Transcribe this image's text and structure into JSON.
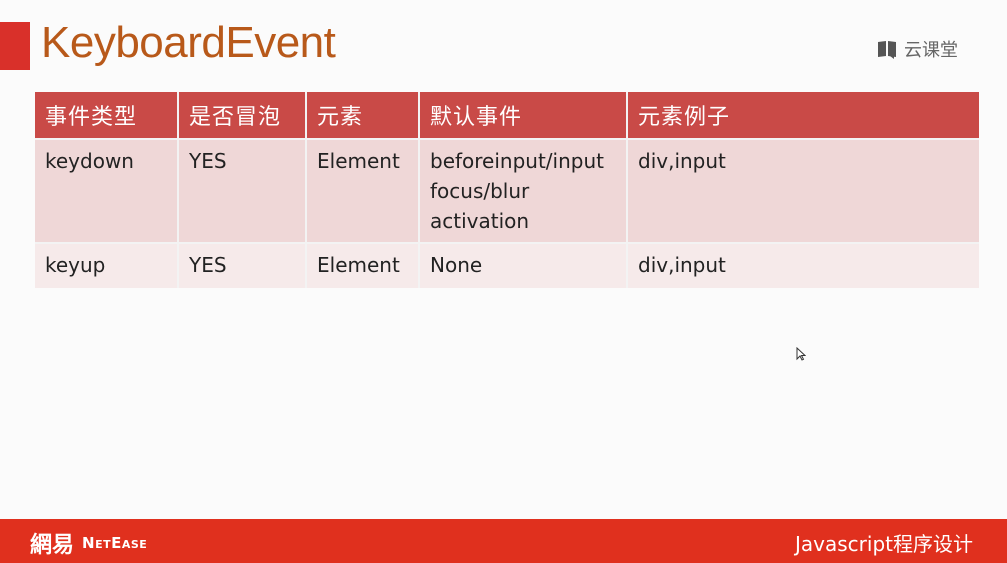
{
  "slide": {
    "title": "KeyboardEvent",
    "brand": "云课堂"
  },
  "table": {
    "headers": [
      "事件类型",
      "是否冒泡",
      "元素",
      "默认事件",
      "元素例子"
    ],
    "rows": [
      {
        "type": "keydown",
        "bubbles": "YES",
        "element": "Element",
        "default_lines": [
          "beforeinput/input",
          "focus/blur",
          "activation"
        ],
        "examples": "div,input"
      },
      {
        "type": "keyup",
        "bubbles": "YES",
        "element": "Element",
        "default_lines": [
          "None"
        ],
        "examples": "div,input"
      }
    ]
  },
  "footer": {
    "logo_cn": "網易",
    "logo_en": "NetEase",
    "course": "Javascript程序设计"
  },
  "colors": {
    "accent": "#d9302a",
    "title": "#b8591a",
    "header_bg": "#c94a47",
    "footer_bg": "#e0301e"
  }
}
